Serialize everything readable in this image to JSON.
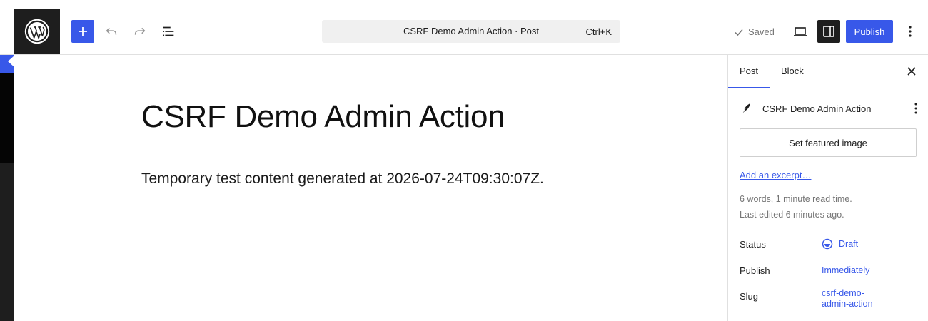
{
  "header": {
    "command_bar_title": "CSRF Demo Admin Action · Post",
    "command_bar_shortcut": "Ctrl+K",
    "saved_label": "Saved",
    "publish_label": "Publish"
  },
  "editor": {
    "title": "CSRF Demo Admin Action",
    "body": "Temporary test content generated at 2026-07-24T09:30:07Z."
  },
  "sidebar": {
    "tabs": [
      {
        "label": "Post",
        "active": true
      },
      {
        "label": "Block",
        "active": false
      }
    ],
    "post_name": "CSRF Demo Admin Action",
    "featured_image_label": "Set featured image",
    "excerpt_link": "Add an excerpt…",
    "word_count": "6 words, 1 minute read time.",
    "last_edited": "Last edited 6 minutes ago.",
    "fields": {
      "status_label": "Status",
      "status_value": "Draft",
      "publish_label": "Publish",
      "publish_value": "Immediately",
      "slug_label": "Slug",
      "slug_value_line1": "csrf-demo-",
      "slug_value_line2": "admin-action"
    }
  },
  "colors": {
    "accent": "#3858e9",
    "dark": "#1e1e1e",
    "muted": "#757575"
  },
  "icons": [
    "wordpress-logo-icon",
    "plus-icon",
    "undo-icon",
    "redo-icon",
    "document-overview-icon",
    "check-icon",
    "desktop-preview-icon",
    "sidebar-settings-icon",
    "more-vertical-icon",
    "close-icon",
    "feather-icon",
    "draft-status-icon"
  ]
}
